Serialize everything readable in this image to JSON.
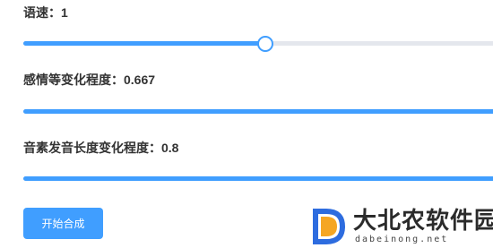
{
  "sliders": [
    {
      "label": "语速：1",
      "value": 1,
      "min": 0,
      "max": 2,
      "fraction": 0.5
    },
    {
      "label": "感情等变化程度：0.667",
      "value": 0.667,
      "min": 0,
      "max": 0.667,
      "fraction": 1.0
    },
    {
      "label": "音素发音长度变化程度：0.8",
      "value": 0.8,
      "min": 0,
      "max": 0.8,
      "fraction": 1.0
    }
  ],
  "actions": {
    "start_label": "开始合成"
  },
  "watermark": {
    "name": "大北农软件园",
    "domain": "dabeinong.net"
  },
  "colors": {
    "accent": "#409eff",
    "track": "#e4e7ed",
    "logo_orange": "#f5a623",
    "logo_blue": "#2d6cdf"
  }
}
